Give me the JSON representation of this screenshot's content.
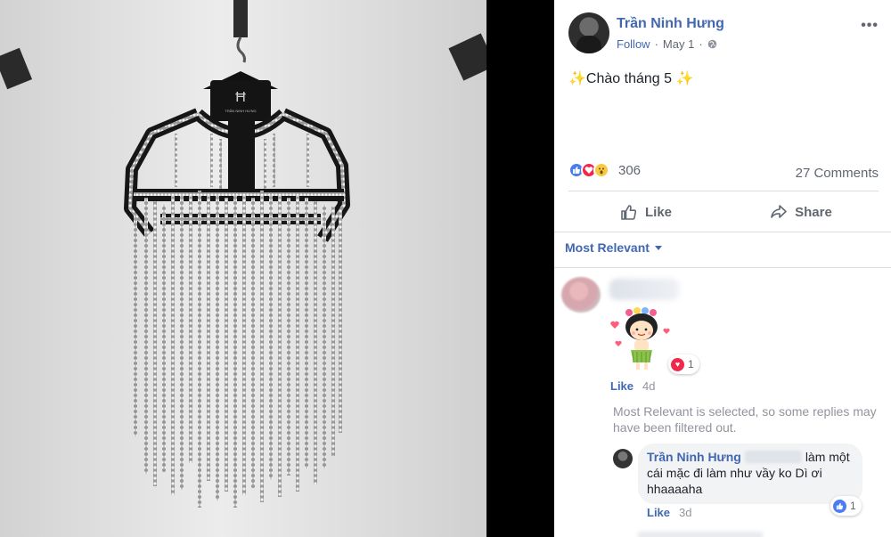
{
  "post": {
    "author": "Trần Ninh Hưng",
    "follow": "Follow",
    "separator": "·",
    "date": "May 1",
    "caption_sparkle_left": "✨",
    "caption_text": "Chào tháng 5",
    "caption_sparkle_right": "✨",
    "more_label": "•••"
  },
  "photo": {
    "hanger_label": "TRẦN NINH HƯNG"
  },
  "reactions": {
    "count": "306",
    "comments": "27 Comments",
    "types": [
      "like-icon",
      "love-icon",
      "wow-icon"
    ]
  },
  "actions": {
    "like": "Like",
    "share": "Share"
  },
  "sort": {
    "label": "Most Relevant"
  },
  "comments": [
    {
      "kind": "sticker",
      "reaction_count": "1",
      "like": "Like",
      "time": "4d"
    }
  ],
  "filter_note": "Most Relevant is selected, so some replies may have been filtered out.",
  "reply": {
    "name": "Trần Ninh Hưng",
    "text_after_tag": "làm một cái mặc đi làm như vầy ko Dì ơi hhaaaaha",
    "reaction_count": "1",
    "like": "Like",
    "time": "3d"
  },
  "colors": {
    "link_blue": "#4267b2",
    "meta_gray": "#616770",
    "love_red": "#f0284a",
    "like_blue": "#4a7df2"
  }
}
